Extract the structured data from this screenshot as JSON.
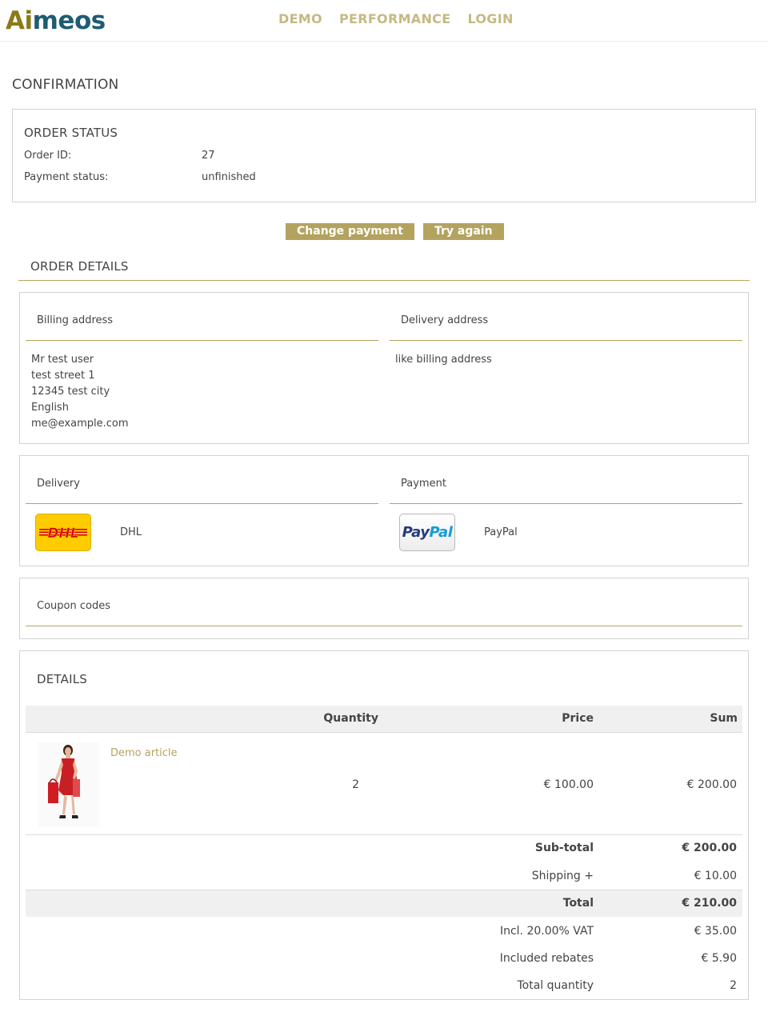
{
  "header": {
    "logo_part1": "Ai",
    "logo_part2": "meos",
    "nav": [
      "DEMO",
      "PERFORMANCE",
      "LOGIN"
    ]
  },
  "page_title": "CONFIRMATION",
  "order_status": {
    "title": "ORDER STATUS",
    "order_id_label": "Order ID:",
    "order_id": "27",
    "payment_status_label": "Payment status:",
    "payment_status": "unfinished"
  },
  "buttons": {
    "change_payment": "Change payment",
    "try_again": "Try again"
  },
  "order_details": {
    "title": "ORDER DETAILS",
    "billing": {
      "title": "Billing address",
      "lines": [
        "Mr test user",
        "test street 1",
        "12345 test city",
        "English",
        "me@example.com"
      ]
    },
    "delivery_address": {
      "title": "Delivery address",
      "text": "like billing address"
    },
    "delivery": {
      "title": "Delivery",
      "logo_text": "DHL",
      "name": "DHL"
    },
    "payment": {
      "title": "Payment",
      "logo_text_1": "Pay",
      "logo_text_2": "Pal",
      "name": "PayPal"
    },
    "coupons": {
      "title": "Coupon codes"
    }
  },
  "details": {
    "title": "DETAILS",
    "columns": {
      "quantity": "Quantity",
      "price": "Price",
      "sum": "Sum"
    },
    "product": {
      "name": "Demo article",
      "quantity": "2",
      "price": "€ 100.00",
      "sum": "€ 200.00"
    },
    "summary": {
      "subtotal_label": "Sub-total",
      "subtotal": "€ 200.00",
      "shipping_label": "Shipping +",
      "shipping": "€ 10.00",
      "total_label": "Total",
      "total": "€ 210.00",
      "vat_label": "Incl. 20.00% VAT",
      "vat": "€ 35.00",
      "rebates_label": "Included rebates",
      "rebates": "€ 5.90",
      "total_quantity_label": "Total quantity",
      "total_quantity": "2"
    }
  },
  "colors": {
    "accent": "#b3a35f",
    "nav": "#c5b983",
    "logo_gold": "#8a7a1a",
    "logo_teal": "#1f5c73",
    "dhl_yellow": "#ffcc00",
    "dhl_red": "#d40511",
    "paypal_dark": "#253b80",
    "paypal_light": "#179bd7"
  }
}
